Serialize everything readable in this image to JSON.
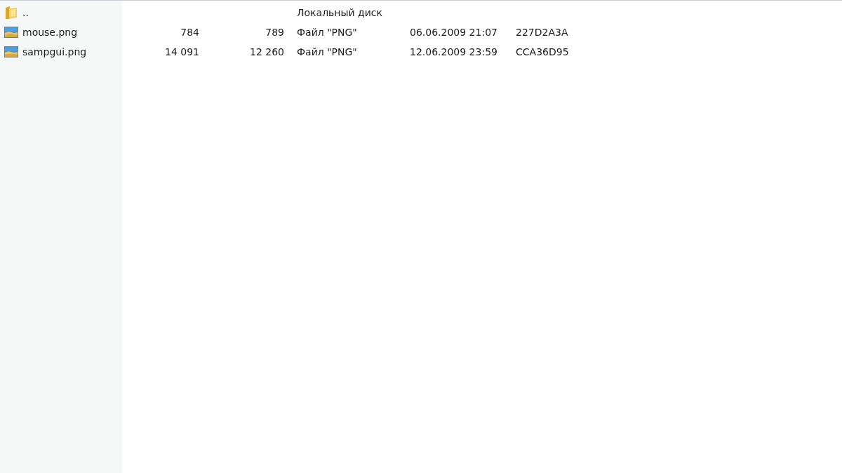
{
  "files": [
    {
      "kind": "folder",
      "name": "..",
      "type": "Локальный диск"
    },
    {
      "kind": "image",
      "name": "mouse.png",
      "size": "784",
      "packed": "789",
      "type": "Файл \"PNG\"",
      "modified": "06.06.2009 21:07",
      "crc": "227D2A3A"
    },
    {
      "kind": "image",
      "name": "sampgui.png",
      "size": "14 091",
      "packed": "12 260",
      "type": "Файл \"PNG\"",
      "modified": "12.06.2009 23:59",
      "crc": "CCA36D95"
    }
  ]
}
